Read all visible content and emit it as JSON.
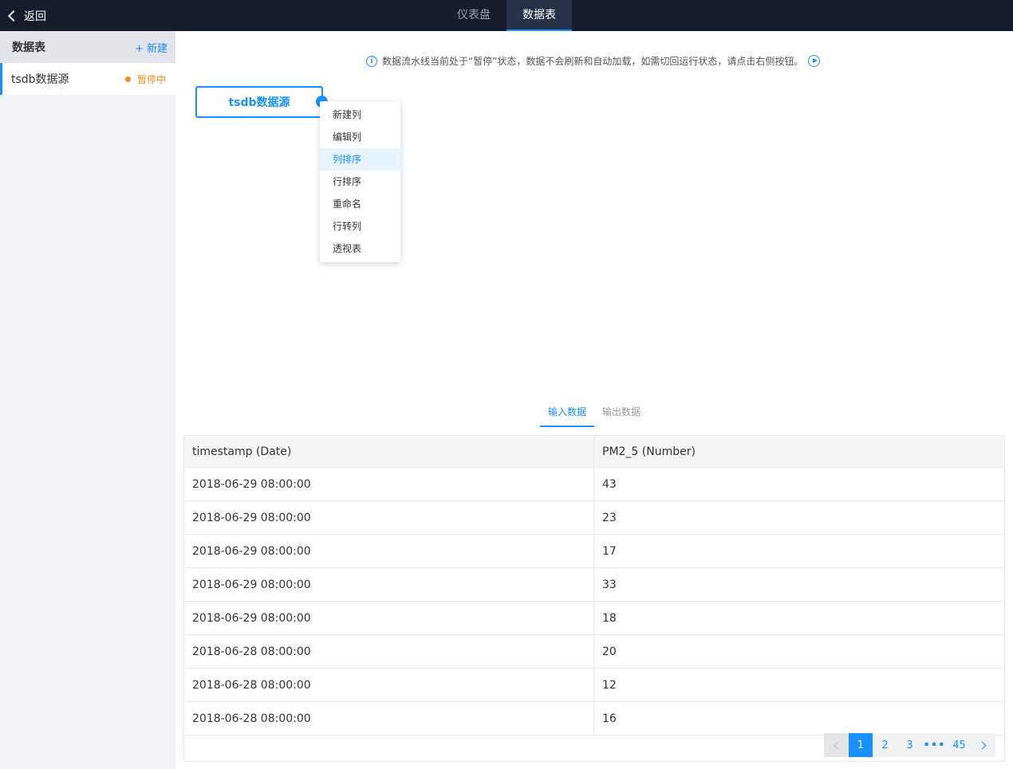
{
  "topbar": {
    "back_label": "返回",
    "tabs": [
      {
        "label": "仪表盘",
        "active": false
      },
      {
        "label": "数据表",
        "active": true
      }
    ]
  },
  "sidebar": {
    "title": "数据表",
    "new_label": "+ 新建",
    "items": [
      {
        "label": "tsdb数据源",
        "status": "暂停中"
      }
    ]
  },
  "notice": {
    "text": "数据流水线当前处于“暂停”状态，数据不会刷新和自动加载，如需切回运行状态，请点击右侧按钮。"
  },
  "node": {
    "label": "tsdb数据源"
  },
  "context_menu": {
    "items": [
      "新建列",
      "编辑列",
      "列排序",
      "行排序",
      "重命名",
      "行转列",
      "透视表"
    ],
    "active_index": 2
  },
  "data_tabs": [
    {
      "label": "输入数据",
      "active": true
    },
    {
      "label": "输出数据",
      "active": false
    }
  ],
  "table": {
    "columns": [
      "timestamp (Date)",
      "PM2_5 (Number)"
    ],
    "rows": [
      [
        "2018-06-29 08:00:00",
        "43"
      ],
      [
        "2018-06-29 08:00:00",
        "23"
      ],
      [
        "2018-06-29 08:00:00",
        "17"
      ],
      [
        "2018-06-29 08:00:00",
        "33"
      ],
      [
        "2018-06-29 08:00:00",
        "18"
      ],
      [
        "2018-06-28 08:00:00",
        "20"
      ],
      [
        "2018-06-28 08:00:00",
        "12"
      ],
      [
        "2018-06-28 08:00:00",
        "16"
      ]
    ]
  },
  "pagination": {
    "pages": [
      "1",
      "2",
      "3"
    ],
    "ellipsis": "•••",
    "last": "45",
    "current": "1"
  }
}
